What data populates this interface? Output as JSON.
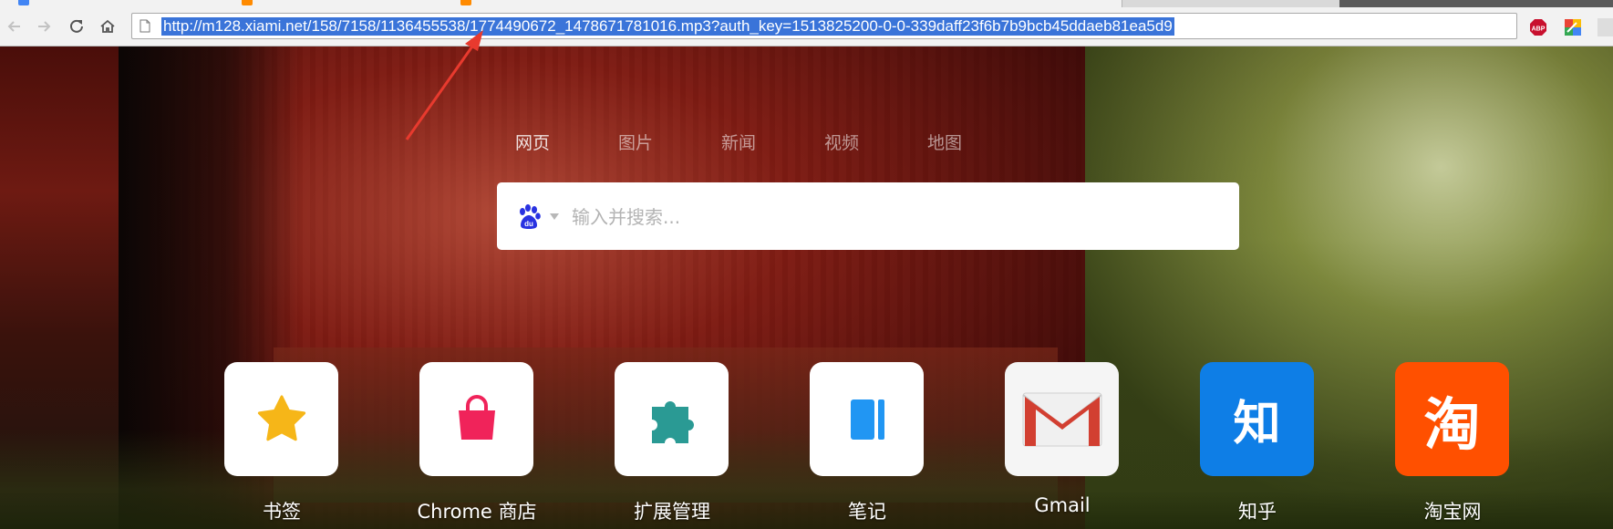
{
  "browser": {
    "url": "http://m128.xiami.net/158/7158/1136455538/1774490672_1478671781016.mp3?auth_key=1513825200-0-0-339daff23f6b7b9bcb45ddaeb81ea5d9",
    "extensions": [
      {
        "icon": "adblock-plus-icon",
        "label": "ABP",
        "color": "#c8102e"
      },
      {
        "icon": "color-picker-extension-icon",
        "color": "#34a853"
      }
    ]
  },
  "search": {
    "tabs": [
      {
        "label": "网页"
      },
      {
        "label": "图片"
      },
      {
        "label": "新闻"
      },
      {
        "label": "视频"
      },
      {
        "label": "地图"
      }
    ],
    "engine_icon": "baidu-paw-icon",
    "placeholder": "输入并搜索..."
  },
  "shortcuts": [
    {
      "label": "书签",
      "icon": "star-icon",
      "bg": "#ffffff",
      "color": "#f6b618"
    },
    {
      "label": "Chrome 商店",
      "icon": "shopping-bag-icon",
      "bg": "#ffffff",
      "color": "#f0235a"
    },
    {
      "label": "扩展管理",
      "icon": "puzzle-piece-icon",
      "bg": "#ffffff",
      "color": "#2a9a94"
    },
    {
      "label": "笔记",
      "icon": "notebook-icon",
      "bg": "#ffffff",
      "color": "#2196f3"
    },
    {
      "label": "Gmail",
      "icon": "gmail-icon",
      "bg": "#f5f5f5",
      "color": "#d23f31"
    },
    {
      "label": "知乎",
      "icon": "zhihu-logo-icon",
      "glyph": "知",
      "bg": "#0e7ee6",
      "color": "#ffffff"
    },
    {
      "label": "淘宝网",
      "icon": "taobao-logo-icon",
      "glyph": "淘",
      "bg": "#ff5000",
      "color": "#ffffff"
    }
  ]
}
